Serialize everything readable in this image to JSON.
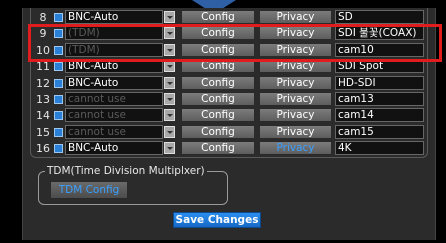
{
  "channels": [
    {
      "num": "8",
      "source": "BNC-Auto",
      "disabled": false,
      "config": "Config",
      "privacy": "Privacy",
      "privacy_active": false,
      "name": "SD"
    },
    {
      "num": "9",
      "source": "(TDM)",
      "disabled": true,
      "config": "Config",
      "privacy": "Privacy",
      "privacy_active": false,
      "name": "SDI 불꽃(COAX)"
    },
    {
      "num": "10",
      "source": "(TDM)",
      "disabled": true,
      "config": "Config",
      "privacy": "Privacy",
      "privacy_active": false,
      "name": "cam10"
    },
    {
      "num": "11",
      "source": "BNC-Auto",
      "disabled": false,
      "config": "Config",
      "privacy": "Privacy",
      "privacy_active": false,
      "name": "SDI Spot"
    },
    {
      "num": "12",
      "source": "BNC-Auto",
      "disabled": false,
      "config": "Config",
      "privacy": "Privacy",
      "privacy_active": false,
      "name": "HD-SDI"
    },
    {
      "num": "13",
      "source": "cannot use",
      "disabled": true,
      "config": "Config",
      "privacy": "Privacy",
      "privacy_active": false,
      "name": "cam13"
    },
    {
      "num": "14",
      "source": "cannot use",
      "disabled": true,
      "config": "Config",
      "privacy": "Privacy",
      "privacy_active": false,
      "name": "cam14"
    },
    {
      "num": "15",
      "source": "cannot use",
      "disabled": true,
      "config": "Config",
      "privacy": "Privacy",
      "privacy_active": false,
      "name": "cam15"
    },
    {
      "num": "16",
      "source": "BNC-Auto",
      "disabled": false,
      "config": "Config",
      "privacy": "Privacy",
      "privacy_active": true,
      "name": "4K"
    }
  ],
  "tdm": {
    "legend": "TDM(Time Division Multiplxer)",
    "button": "TDM Config"
  },
  "save_label": "Save Changes",
  "colors": {
    "background": "#2b2b2b",
    "accent": "#2a7fd6",
    "active_text": "#3aa0ff",
    "highlight": "#e01c1c"
  }
}
